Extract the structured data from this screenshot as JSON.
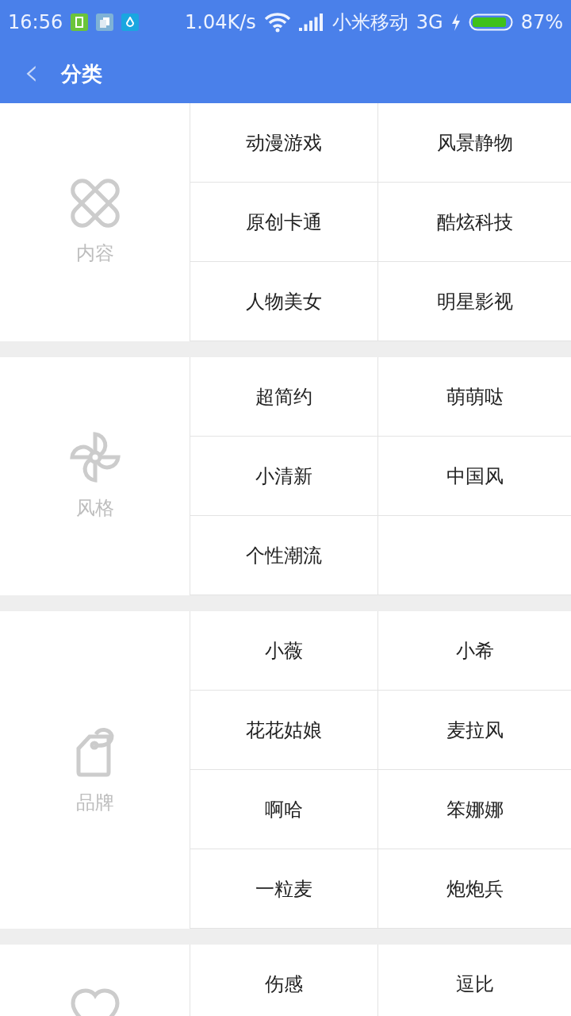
{
  "status_bar": {
    "time": "16:56",
    "speed": "1.04K/s",
    "carrier": "小米移动",
    "network": "3G",
    "battery": "87%"
  },
  "header": {
    "back": "‹",
    "title": "分类"
  },
  "sections": [
    {
      "kind": "knot",
      "label": "内容",
      "items": [
        "动漫游戏",
        "风景静物",
        "原创卡通",
        "酷炫科技",
        "人物美女",
        "明星影视"
      ]
    },
    {
      "kind": "fan",
      "label": "风格",
      "items": [
        "超简约",
        "萌萌哒",
        "小清新",
        "中国风",
        "个性潮流"
      ]
    },
    {
      "kind": "tag",
      "label": "品牌",
      "items": [
        "小薇",
        "小希",
        "花花姑娘",
        "麦拉风",
        "啊哈",
        "笨娜娜",
        "一粒麦",
        "炮炮兵"
      ]
    },
    {
      "kind": "heart",
      "items": [
        "伤感",
        "逗比"
      ]
    }
  ]
}
